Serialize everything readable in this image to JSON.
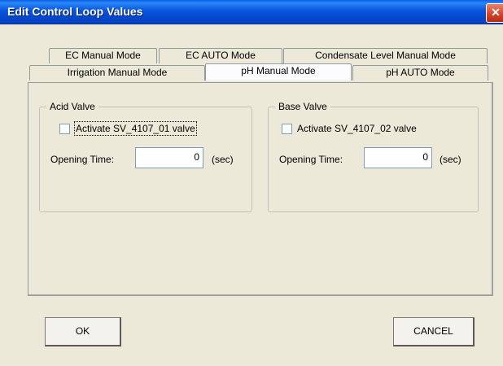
{
  "window": {
    "title": "Edit Control Loop Values",
    "close_glyph": "✕"
  },
  "tabs_back": [
    {
      "label": "EC Manual Mode"
    },
    {
      "label": "EC AUTO Mode"
    },
    {
      "label": "Condensate Level Manual Mode"
    }
  ],
  "tabs_front": [
    {
      "label": "Irrigation Manual Mode"
    },
    {
      "label": "pH Manual Mode",
      "active": true
    },
    {
      "label": "pH AUTO Mode"
    }
  ],
  "acid_valve": {
    "title": "Acid Valve",
    "checkbox_label": "Activate SV_4107_01 valve",
    "checked": false,
    "opening_time_label": "Opening Time:",
    "opening_time_value": "0",
    "unit": "(sec)"
  },
  "base_valve": {
    "title": "Base Valve",
    "checkbox_label": "Activate SV_4107_02 valve",
    "checked": false,
    "opening_time_label": "Opening Time:",
    "opening_time_value": "0",
    "unit": "(sec)"
  },
  "buttons": {
    "ok": "OK",
    "cancel": "CANCEL"
  }
}
